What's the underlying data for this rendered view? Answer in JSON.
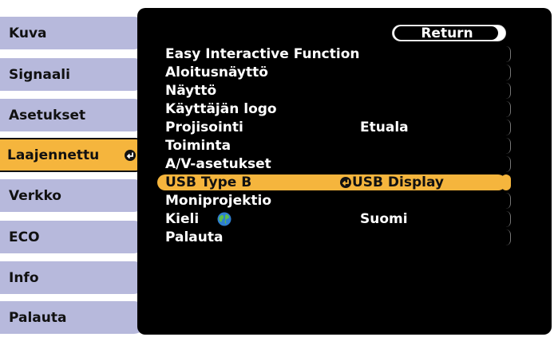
{
  "sidebar": {
    "tabs": [
      {
        "label": "Kuva",
        "active": false
      },
      {
        "label": "Signaali",
        "active": false
      },
      {
        "label": "Asetukset",
        "active": false
      },
      {
        "label": "Laajennettu",
        "active": true
      },
      {
        "label": "Verkko",
        "active": false
      },
      {
        "label": "ECO",
        "active": false
      },
      {
        "label": "Info",
        "active": false
      },
      {
        "label": "Palauta",
        "active": false
      }
    ]
  },
  "panel": {
    "return_label": "Return",
    "rows": [
      {
        "label": "Easy Interactive Function",
        "value": ""
      },
      {
        "label": "Aloitusnäyttö",
        "value": ""
      },
      {
        "label": "Näyttö",
        "value": ""
      },
      {
        "label": "Käyttäjän logo",
        "value": ""
      },
      {
        "label": "Projisointi",
        "value": "Etuala"
      },
      {
        "label": "Toiminta",
        "value": ""
      },
      {
        "label": "A/V-asetukset",
        "value": ""
      },
      {
        "label": "USB Type B",
        "value": "USB Display",
        "highlighted": true
      },
      {
        "label": "Moniprojektio",
        "value": ""
      },
      {
        "label": "Kieli",
        "value": "Suomi"
      },
      {
        "label": "Palauta",
        "value": ""
      }
    ]
  },
  "colors": {
    "tab_inactive": "#b7b9dc",
    "tab_active": "#f5b53d",
    "panel_bg": "#000000",
    "highlight": "#f5b53d"
  },
  "icons": {
    "enter": "enter-icon",
    "language": "globe-icon"
  }
}
